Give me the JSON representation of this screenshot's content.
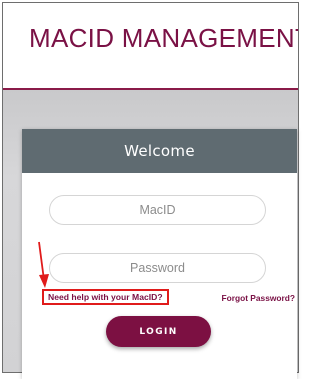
{
  "header": {
    "title": "MACID MANAGEMENT"
  },
  "login_card": {
    "title": "Welcome",
    "macid_field": {
      "placeholder": "MacID",
      "value": ""
    },
    "password_field": {
      "placeholder": "Password",
      "value": ""
    },
    "help_link": "Need help with your MacID?",
    "forgot_link": "Forgot Password?",
    "login_button": "LOGIN"
  },
  "colors": {
    "brand": "#7a1145",
    "card_header": "#5f6b71",
    "annotation": "#e01b1b"
  },
  "icons": {
    "annotation_arrow": "red-arrow-icon"
  }
}
